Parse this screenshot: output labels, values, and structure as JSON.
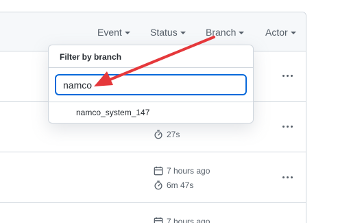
{
  "filters": {
    "event": "Event",
    "status": "Status",
    "branch": "Branch",
    "actor": "Actor"
  },
  "dropdown": {
    "title": "Filter by branch",
    "input_value": "namco",
    "items": [
      "namco_system_147"
    ]
  },
  "rows": [
    {
      "time": "",
      "duration": ""
    },
    {
      "time": "",
      "duration": "27s"
    },
    {
      "time": "7 hours ago",
      "duration": "6m 47s"
    },
    {
      "time": "7 hours ago",
      "duration": ""
    }
  ],
  "colors": {
    "annotation_arrow": "#e5383b",
    "focus_ring": "#0969da"
  }
}
